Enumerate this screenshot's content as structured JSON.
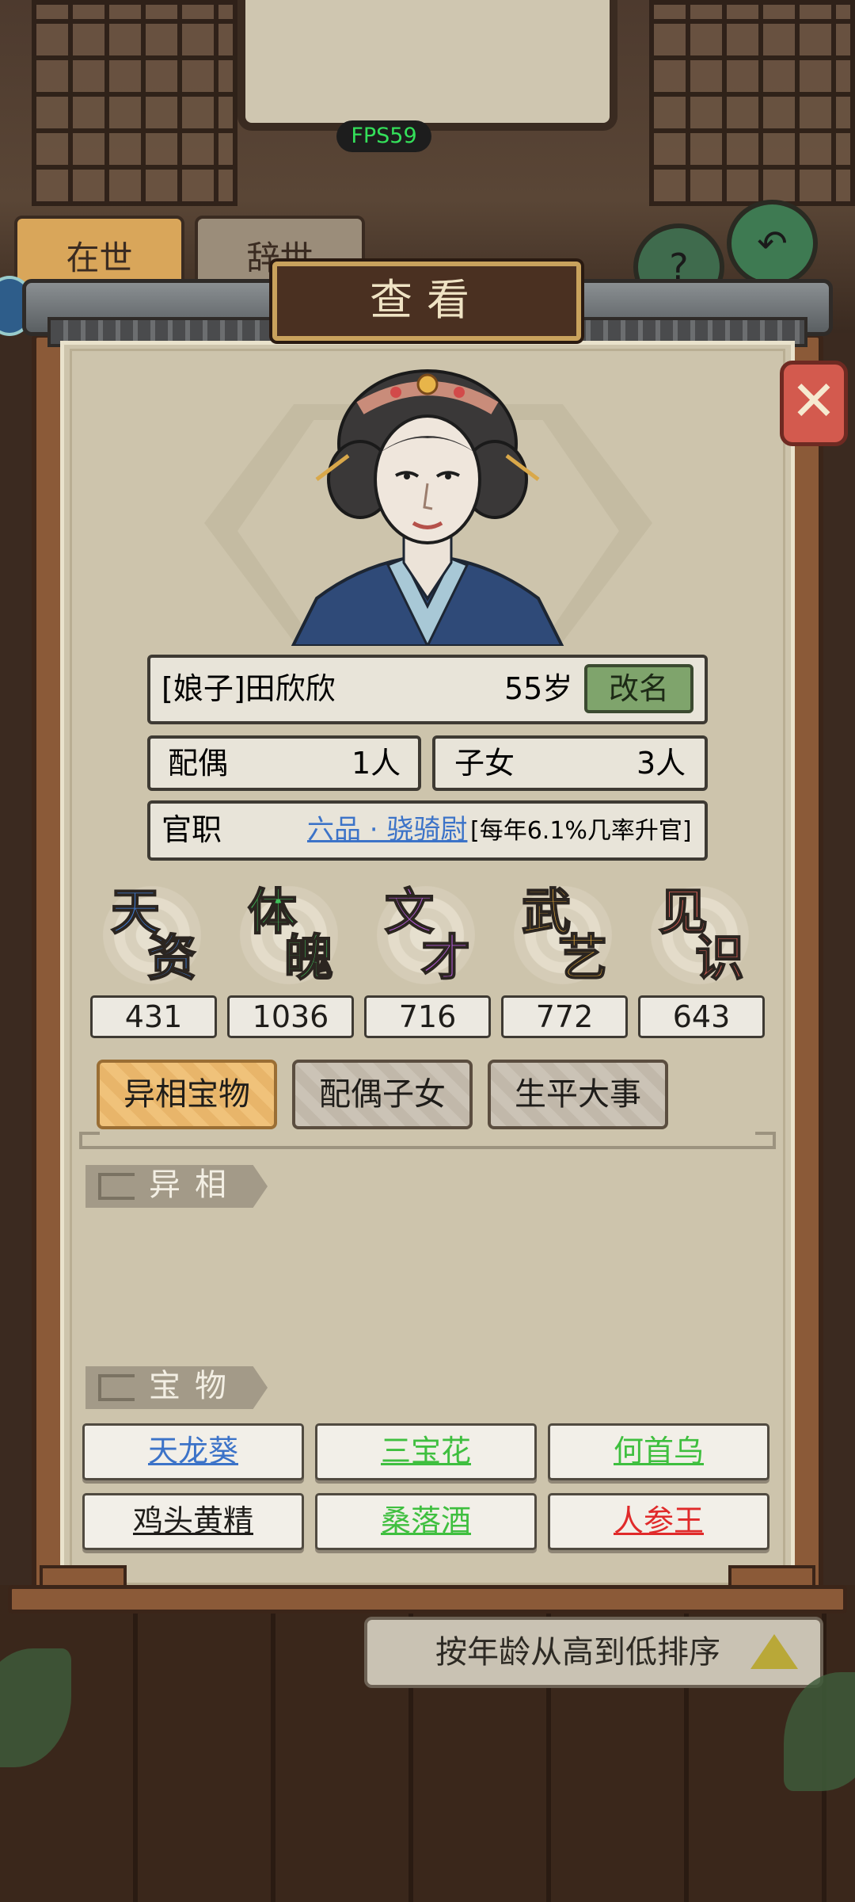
{
  "background": {
    "fps_label": "FPS59",
    "tab_alive": "在世",
    "tab_dead": "辞世",
    "help_label": "?",
    "sort_label": "按年龄从高到低排序"
  },
  "dialog": {
    "title": "查看",
    "close_icon": "close-icon"
  },
  "profile": {
    "name": "[娘子]田欣欣",
    "age": "55岁",
    "rename_button": "改名",
    "spouse_label": "配偶",
    "spouse_count": "1人",
    "children_label": "子女",
    "children_count": "3人",
    "office_label": "官职",
    "office_rank": "六品 · 骁骑尉",
    "office_promotion": "[每年6.1%几率升官]"
  },
  "attributes": [
    {
      "top": "天",
      "bottom": "资",
      "value": "431",
      "color": "#3f7ed8"
    },
    {
      "top": "体",
      "bottom": "魄",
      "value": "1036",
      "color": "#3fbf5a"
    },
    {
      "top": "文",
      "bottom": "才",
      "value": "716",
      "color": "#b35ad6"
    },
    {
      "top": "武",
      "bottom": "艺",
      "value": "772",
      "color": "#e3a93a"
    },
    {
      "top": "见",
      "bottom": "识",
      "value": "643",
      "color": "#e0645a"
    }
  ],
  "tabs": [
    {
      "label": "异相宝物",
      "active": true
    },
    {
      "label": "配偶子女",
      "active": false
    },
    {
      "label": "生平大事",
      "active": false
    }
  ],
  "sections": {
    "traits_title": "异相",
    "treasures_title": "宝物"
  },
  "treasures": [
    {
      "name": "天龙葵",
      "color": "#3c73c8"
    },
    {
      "name": "三宝花",
      "color": "#3fbf3f"
    },
    {
      "name": "何首乌",
      "color": "#3fbf3f"
    },
    {
      "name": "鸡头黄精",
      "color": "#1f1d1a"
    },
    {
      "name": "桑落酒",
      "color": "#3fbf3f"
    },
    {
      "name": "人参王",
      "color": "#e02a2a"
    }
  ]
}
